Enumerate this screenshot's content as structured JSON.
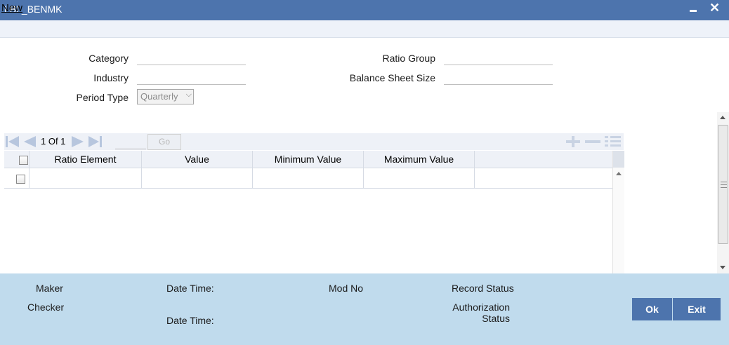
{
  "window": {
    "title": "LBL_BENMK",
    "minimize_symbol": "_",
    "close_symbol": "✕"
  },
  "menu": {
    "new_label": "New"
  },
  "form": {
    "category_label": "Category",
    "category_value": "",
    "industry_label": "Industry",
    "industry_value": "",
    "period_type_label": "Period Type",
    "period_type_value": "Quarterly",
    "ratio_group_label": "Ratio Group",
    "ratio_group_value": "",
    "balance_sheet_size_label": "Balance Sheet Size",
    "balance_sheet_size_value": ""
  },
  "grid": {
    "pager": {
      "page_text": "1 Of 1",
      "go_label": "Go",
      "page_input": ""
    },
    "columns": [
      "Ratio Element",
      "Value",
      "Minimum Value",
      "Maximum Value"
    ],
    "rows": [
      {
        "ratio_element": "",
        "value": "",
        "minimum_value": "",
        "maximum_value": ""
      }
    ]
  },
  "footer": {
    "maker_label": "Maker",
    "checker_label": "Checker",
    "date_time_label": "Date Time:",
    "date_time_label_2": "Date Time:",
    "mod_no_label": "Mod No",
    "record_status_label": "Record Status",
    "authorization_label_line1": "Authorization",
    "authorization_label_line2": "Status"
  },
  "buttons": {
    "ok_label": "Ok",
    "exit_label": "Exit"
  },
  "colors": {
    "title_bar": "#4d74ad",
    "footer_bg": "#c0dbed",
    "button_bg": "#4d74ad",
    "grid_header_bg": "#eef1f7"
  }
}
